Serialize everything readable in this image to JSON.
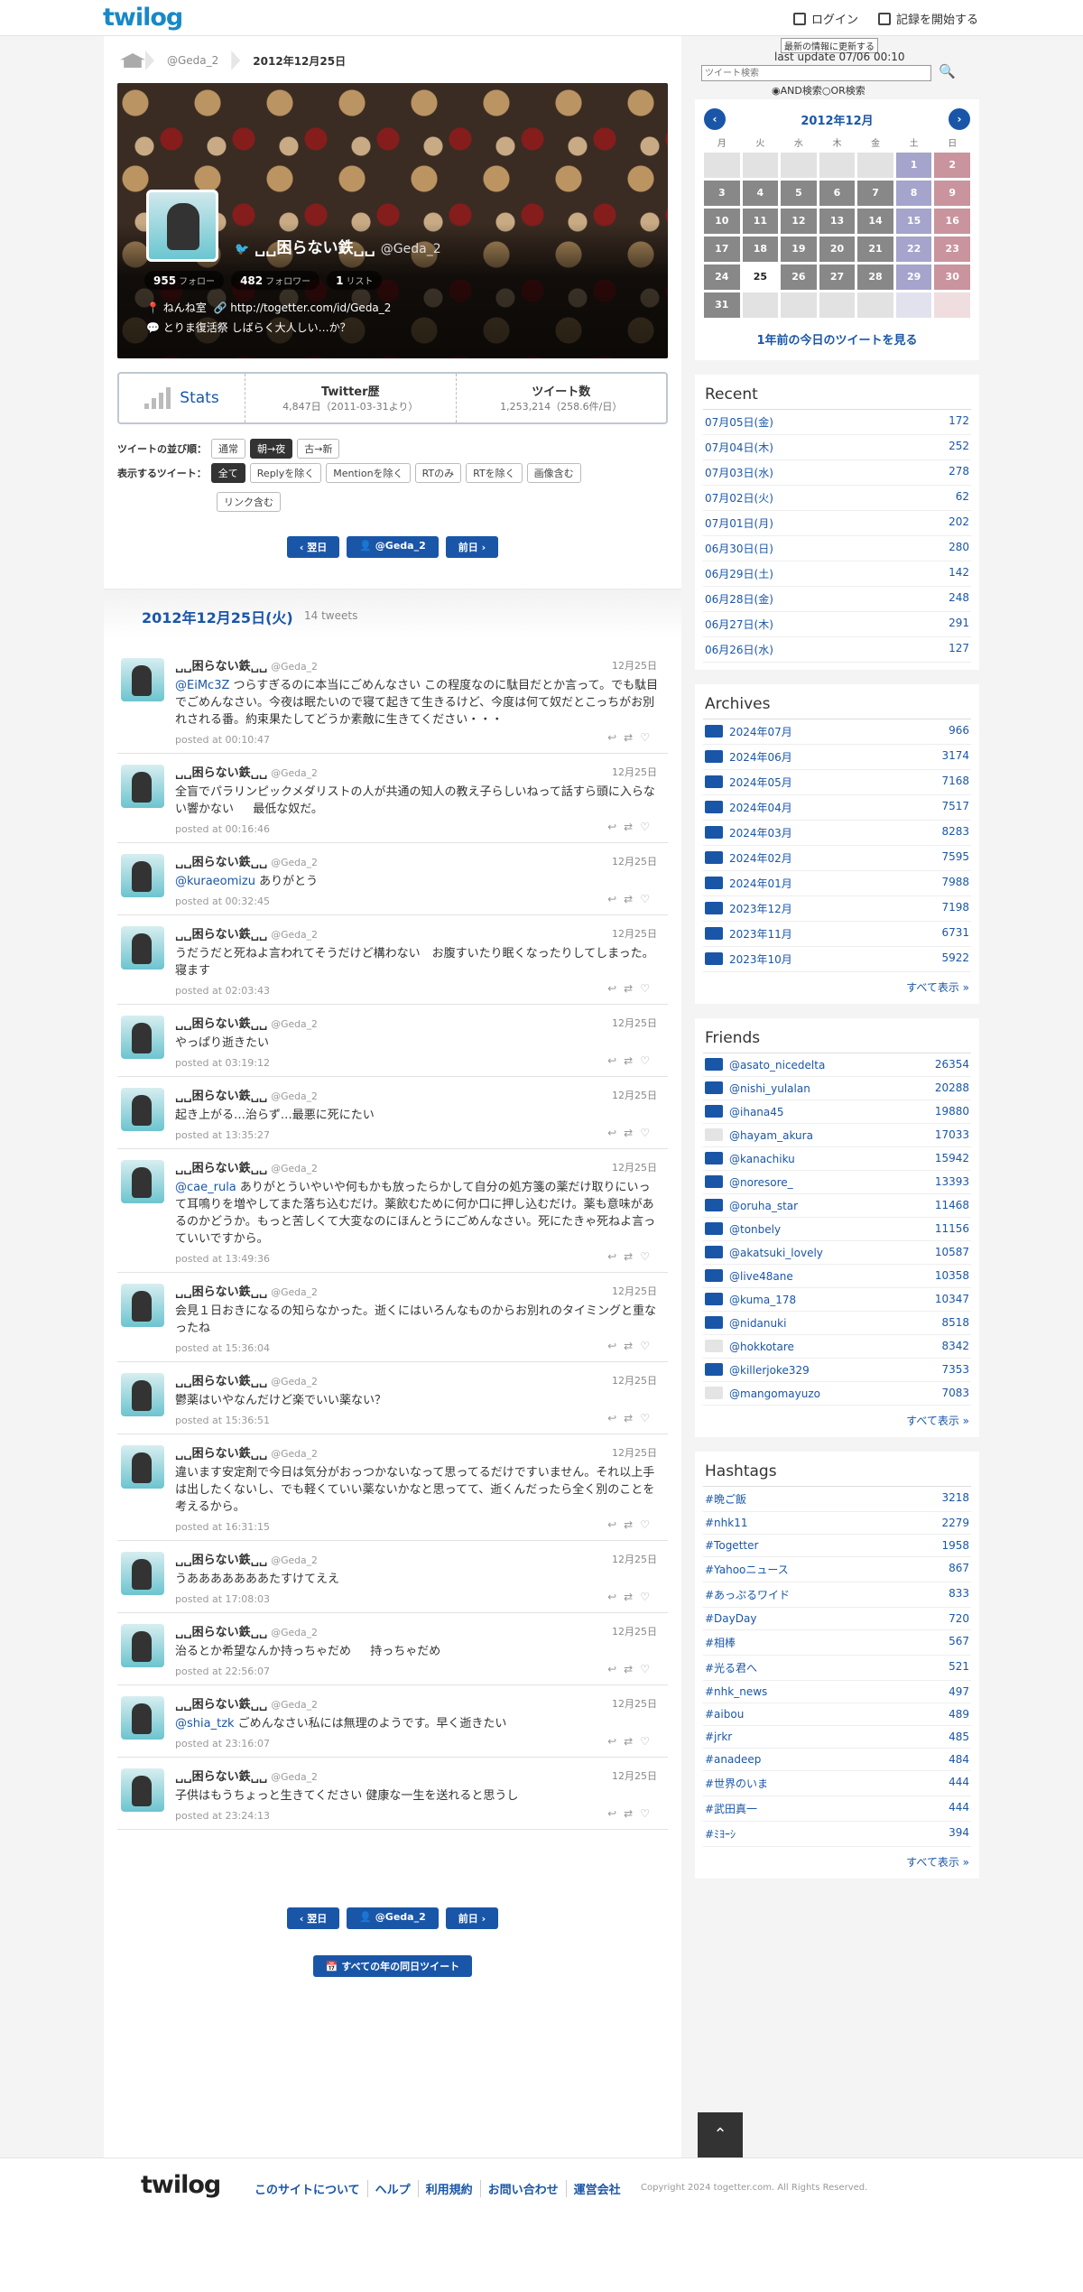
{
  "header": {
    "logo": "twilog",
    "login": "ログイン",
    "signup": "記録を開始する"
  },
  "crumb": {
    "user": "@Geda_2",
    "date": "2012年12月25日"
  },
  "profile": {
    "name": "␣␣困らない鉄␣␣",
    "handle": "@Geda_2",
    "followers": "955",
    "followers_label": "フォロー",
    "following": "482",
    "following_label": "フォロワー",
    "lists": "1",
    "lists_label": "リスト",
    "location": "ねんね室",
    "url": "http://togetter.com/id/Geda_2",
    "desc": "とりま復活祭 しばらく大人しい…か？"
  },
  "stats": {
    "label": "Stats",
    "history_title": "Twitter歴",
    "history": "4,847日",
    "history_since": "（2011-03-31より）",
    "count_title": "ツイート数",
    "count": "1,253,214",
    "count_rate": "（258.6件/日）"
  },
  "order": {
    "label": "ツイートの並び順：",
    "o1": "通常",
    "o2": "朝→夜",
    "o3": "古→新"
  },
  "filter": {
    "label": "表示するツイート：",
    "f1": "全て",
    "f2": "Replyを除く",
    "f3": "Mentionを除く",
    "f4": "RTのみ",
    "f5": "RTを除く",
    "f6": "画像含む",
    "f7": "リンク含む"
  },
  "pager": {
    "next": "翌日",
    "user": "@Geda_2",
    "prev": "前日",
    "allyears": "すべての年の同日ツイート"
  },
  "day": {
    "title": "2012年12月25日(火)",
    "count": "14 tweets"
  },
  "tweets": [
    {
      "date": "12月25日",
      "mention": "@EiMc3Z",
      "text": " つらすぎるのに本当にごめんなさい この程度なのに駄目だとか言って。でも駄目でごめんなさい。今夜は眠たいので寝て起きて生きるけど、今度は何て奴だとこっちがお別れされる番。約束果たしてどうか素敵に生きてください・・・",
      "time": "posted at 00:10:47"
    },
    {
      "date": "12月25日",
      "mention": "",
      "text": "全盲でパラリンピックメダリストの人が共通の知人の教え子らしいねって話すら頭に入らない響かない 　 最低な奴だ。",
      "time": "posted at 00:16:46"
    },
    {
      "date": "12月25日",
      "mention": "@kuraeomizu",
      "text": " ありがとう",
      "time": "posted at 00:32:45"
    },
    {
      "date": "12月25日",
      "mention": "",
      "text": "うだうだと死ねよ言われてそうだけど構わない　お腹すいたり眠くなったりしてしまった。寝ます",
      "time": "posted at 02:03:43"
    },
    {
      "date": "12月25日",
      "mention": "",
      "text": "やっぱり逝きたい",
      "time": "posted at 03:19:12"
    },
    {
      "date": "12月25日",
      "mention": "",
      "text": "起き上がる…治らず…最悪に死にたい",
      "time": "posted at 13:35:27"
    },
    {
      "date": "12月25日",
      "mention": "@cae_rula",
      "text": " ありがとういやいや何もかも放ったらかして自分の処方箋の薬だけ取りにいって耳鳴りを増やしてまた落ち込むだけ。薬飲むために何か口に押し込むだけ。薬も意味があるのかどうか。もっと苦しくて大変なのにほんとうにごめんなさい。死にたきゃ死ねよ言っていいですから。",
      "time": "posted at 13:49:36"
    },
    {
      "date": "12月25日",
      "mention": "",
      "text": "会見１日おきになるの知らなかった。逝くにはいろんなものからお別れのタイミングと重なったね",
      "time": "posted at 15:36:04"
    },
    {
      "date": "12月25日",
      "mention": "",
      "text": "鬱薬はいやなんだけど楽でいい薬ない？",
      "time": "posted at 15:36:51"
    },
    {
      "date": "12月25日",
      "mention": "",
      "text": "違います安定剤で今日は気分がおっつかないなって思ってるだけですいません。それ以上手は出したくないし、でも軽くていい薬ないかなと思ってて、逝くんだったら全く別のことを考えるから。",
      "time": "posted at 16:31:15"
    },
    {
      "date": "12月25日",
      "mention": "",
      "text": "うあああああああたすけてええ",
      "time": "posted at 17:08:03"
    },
    {
      "date": "12月25日",
      "mention": "",
      "text": "治るとか希望なんか持っちゃだめ 　 持っちゃだめ",
      "time": "posted at 22:56:07"
    },
    {
      "date": "12月25日",
      "mention": "@shia_tzk",
      "text": " ごめんなさい私には無理のようです。早く逝きたい",
      "time": "posted at 23:16:07"
    },
    {
      "date": "12月25日",
      "mention": "",
      "text": "子供はもうちょっと生きてください 健康な一生を送れると思うし",
      "time": "posted at 23:24:13"
    }
  ],
  "side": {
    "update_btn": "最新の情報に更新する",
    "last_update": "last update 07/06 00:10",
    "search_ph": "ツイート検索",
    "and": "AND検索",
    "or": "OR検索",
    "cal_title": "2012年12月",
    "dows": [
      "月",
      "火",
      "水",
      "木",
      "金",
      "土",
      "日"
    ],
    "year_ago": "1年前の今日のツイートを見る",
    "recent_title": "Recent",
    "recent": [
      [
        "07月05日(金)",
        "172"
      ],
      [
        "07月04日(木)",
        "252"
      ],
      [
        "07月03日(水)",
        "278"
      ],
      [
        "07月02日(火)",
        "62"
      ],
      [
        "07月01日(月)",
        "202"
      ],
      [
        "06月30日(日)",
        "280"
      ],
      [
        "06月29日(土)",
        "142"
      ],
      [
        "06月28日(金)",
        "248"
      ],
      [
        "06月27日(木)",
        "291"
      ],
      [
        "06月26日(水)",
        "127"
      ]
    ],
    "archives_title": "Archives",
    "archives": [
      [
        "2024年07月",
        "966"
      ],
      [
        "2024年06月",
        "3174"
      ],
      [
        "2024年05月",
        "7168"
      ],
      [
        "2024年04月",
        "7517"
      ],
      [
        "2024年03月",
        "8283"
      ],
      [
        "2024年02月",
        "7595"
      ],
      [
        "2024年01月",
        "7988"
      ],
      [
        "2023年12月",
        "7198"
      ],
      [
        "2023年11月",
        "6731"
      ],
      [
        "2023年10月",
        "5922"
      ]
    ],
    "more": "すべて表示 »",
    "friends_title": "Friends",
    "friends": [
      [
        "@asato_nicedelta",
        "26354"
      ],
      [
        "@nishi_yulalan",
        "20288"
      ],
      [
        "@ihana45",
        "19880"
      ],
      [
        "@hayam_akura",
        "17033"
      ],
      [
        "@kanachiku",
        "15942"
      ],
      [
        "@noresore_",
        "13393"
      ],
      [
        "@oruha_star",
        "11468"
      ],
      [
        "@tonbely",
        "11156"
      ],
      [
        "@akatsuki_lovely",
        "10587"
      ],
      [
        "@live48ane",
        "10358"
      ],
      [
        "@kuma_178",
        "10347"
      ],
      [
        "@nidanuki",
        "8518"
      ],
      [
        "@hokkotare",
        "8342"
      ],
      [
        "@killerjoke329",
        "7353"
      ],
      [
        "@mangomayuzo",
        "7083"
      ]
    ],
    "hashtags_title": "Hashtags",
    "hashtags": [
      [
        "#晩ご飯",
        "3218"
      ],
      [
        "#nhk11",
        "2279"
      ],
      [
        "#Togetter",
        "1958"
      ],
      [
        "#Yahooニュース",
        "867"
      ],
      [
        "#あっぷるワイド",
        "833"
      ],
      [
        "#DayDay",
        "720"
      ],
      [
        "#相棒",
        "567"
      ],
      [
        "#光る君へ",
        "521"
      ],
      [
        "#nhk_news",
        "497"
      ],
      [
        "#aibou",
        "489"
      ],
      [
        "#jrkr",
        "485"
      ],
      [
        "#anadeep",
        "484"
      ],
      [
        "#世界のいま",
        "444"
      ],
      [
        "#武田真一",
        "444"
      ],
      [
        "#ﾐﾖｰｼ",
        "394"
      ]
    ]
  },
  "footer": {
    "logo": "twilog",
    "l1": "このサイトについて",
    "l2": "ヘルプ",
    "l3": "利用規約",
    "l4": "お問い合わせ",
    "l5": "運営会社",
    "copy": "Copyright 2024 togetter.com. All Rights Reserved."
  }
}
